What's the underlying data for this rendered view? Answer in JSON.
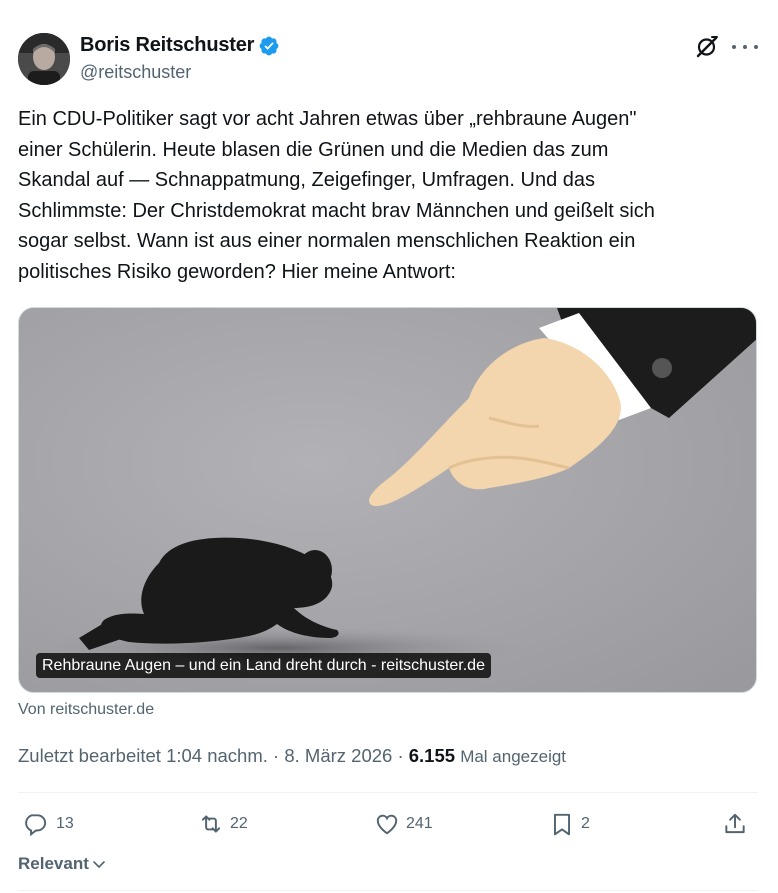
{
  "author": {
    "name": "Boris Reitschuster",
    "handle": "@reitschuster",
    "verified": true
  },
  "tweet": {
    "text": "Ein CDU-Politiker sagt vor acht Jahren etwas über „rehbraune Augen\"\neiner Schülerin. Heute blasen die Grünen und die Medien das zum\nSkandal auf — Schnappatmung, Zeigefinger, Umfragen. Und das\nSchlimmste: Der Christdemokrat macht brav Männchen und geißelt sich\nsogar selbst. Wann ist aus einer normalen menschlichen Reaktion ein\npolitisches Risiko geworden? Hier meine Antwort:"
  },
  "card": {
    "caption": "Rehbraune Augen – und ein Land dreht durch - reitschuster.de",
    "source": "Von reitschuster.de"
  },
  "meta": {
    "edited": "Zuletzt bearbeitet 1:04 nachm. · 8. März 2026 · ",
    "views": "6.155",
    "views_label": "Mal angezeigt"
  },
  "actions": {
    "replies": "13",
    "reposts": "22",
    "likes": "241",
    "bookmarks": "2"
  },
  "sort": {
    "label": "Relevant"
  },
  "icons": {
    "verified": "verified-badge-icon",
    "grok": "grok-icon",
    "more": "more-icon",
    "reply": "reply-icon",
    "repost": "repost-icon",
    "like": "heart-icon",
    "bookmark": "bookmark-icon",
    "share": "share-icon",
    "chevron": "chevron-down-icon"
  },
  "colors": {
    "text": "#0f1419",
    "secondary": "#536471",
    "verified": "#1d9bf0",
    "divider": "#eff3f4"
  }
}
